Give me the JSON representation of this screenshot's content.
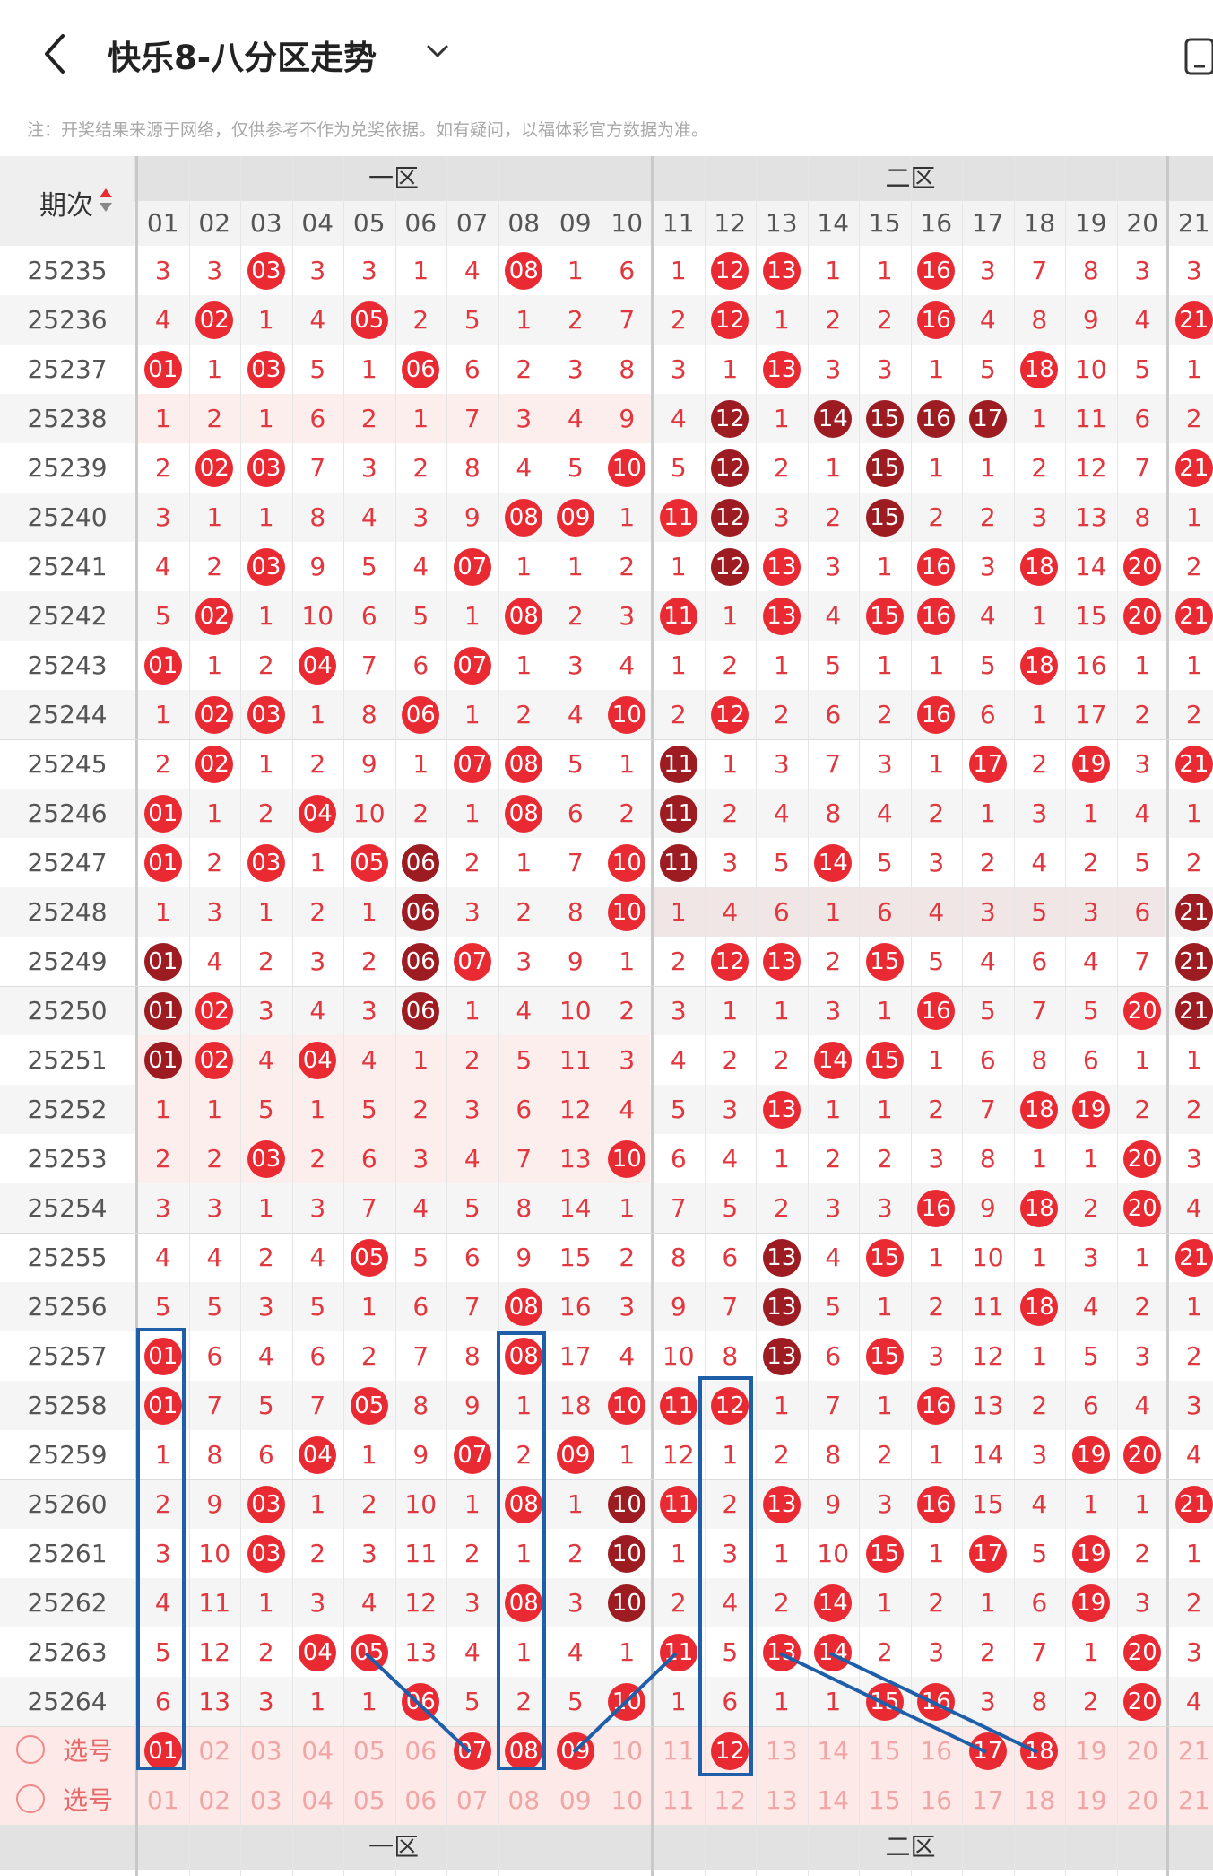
{
  "header": {
    "title": "快乐8-八分区走势",
    "note": "注：开奖结果来源于网络，仅供参考不作为兑奖依据。如有疑问，以福体彩官方数据为准。"
  },
  "table": {
    "period_label": "期次",
    "zones": [
      "一区",
      "二区"
    ],
    "columns": [
      "01",
      "02",
      "03",
      "04",
      "05",
      "06",
      "07",
      "08",
      "09",
      "10",
      "11",
      "12",
      "13",
      "14",
      "15",
      "16",
      "17",
      "18",
      "19",
      "20",
      "21"
    ],
    "rows": [
      {
        "period": "25235",
        "cells": [
          "3",
          "3",
          "03",
          "3",
          "3",
          "1",
          "4",
          "08",
          "1",
          "6",
          "1",
          "12",
          "13",
          "1",
          "1",
          "16",
          "3",
          "7",
          "8",
          "3",
          "3"
        ]
      },
      {
        "period": "25236",
        "cells": [
          "4",
          "02",
          "1",
          "4",
          "05",
          "2",
          "5",
          "1",
          "2",
          "7",
          "2",
          "12",
          "1",
          "2",
          "2",
          "16",
          "4",
          "8",
          "9",
          "4",
          "21"
        ]
      },
      {
        "period": "25237",
        "cells": [
          "01",
          "1",
          "03",
          "5",
          "1",
          "06",
          "6",
          "2",
          "3",
          "8",
          "3",
          "1",
          "13",
          "3",
          "3",
          "1",
          "5",
          "18",
          "10",
          "5",
          "1"
        ]
      },
      {
        "period": "25238",
        "cells": [
          "1",
          "2",
          "1",
          "6",
          "2",
          "1",
          "7",
          "3",
          "4",
          "9",
          "4",
          "12",
          "1",
          "14",
          "15",
          "16",
          "17",
          "1",
          "11",
          "6",
          "2"
        ]
      },
      {
        "period": "25239",
        "cells": [
          "2",
          "02",
          "03",
          "7",
          "3",
          "2",
          "8",
          "4",
          "5",
          "10",
          "5",
          "12",
          "2",
          "1",
          "15",
          "1",
          "1",
          "2",
          "12",
          "7",
          "21"
        ]
      },
      {
        "period": "25240",
        "cells": [
          "3",
          "1",
          "1",
          "8",
          "4",
          "3",
          "9",
          "08",
          "09",
          "1",
          "11",
          "12",
          "3",
          "2",
          "15",
          "2",
          "2",
          "3",
          "13",
          "8",
          "1"
        ]
      },
      {
        "period": "25241",
        "cells": [
          "4",
          "2",
          "03",
          "9",
          "5",
          "4",
          "07",
          "1",
          "1",
          "2",
          "1",
          "12",
          "13",
          "3",
          "1",
          "16",
          "3",
          "18",
          "14",
          "20",
          "2"
        ]
      },
      {
        "period": "25242",
        "cells": [
          "5",
          "02",
          "1",
          "10",
          "6",
          "5",
          "1",
          "08",
          "2",
          "3",
          "11",
          "1",
          "13",
          "4",
          "15",
          "16",
          "4",
          "1",
          "15",
          "20",
          "21"
        ]
      },
      {
        "period": "25243",
        "cells": [
          "01",
          "1",
          "2",
          "04",
          "7",
          "6",
          "07",
          "1",
          "3",
          "4",
          "1",
          "2",
          "1",
          "5",
          "1",
          "1",
          "5",
          "18",
          "16",
          "1",
          "1"
        ]
      },
      {
        "period": "25244",
        "cells": [
          "1",
          "02",
          "03",
          "1",
          "8",
          "06",
          "1",
          "2",
          "4",
          "10",
          "2",
          "12",
          "2",
          "6",
          "2",
          "16",
          "6",
          "1",
          "17",
          "2",
          "2"
        ]
      },
      {
        "period": "25245",
        "cells": [
          "2",
          "02",
          "1",
          "2",
          "9",
          "1",
          "07",
          "08",
          "5",
          "1",
          "11",
          "1",
          "3",
          "7",
          "3",
          "1",
          "17",
          "2",
          "19",
          "3",
          "21"
        ]
      },
      {
        "period": "25246",
        "cells": [
          "01",
          "1",
          "2",
          "04",
          "10",
          "2",
          "1",
          "08",
          "6",
          "2",
          "11",
          "2",
          "4",
          "8",
          "4",
          "2",
          "1",
          "3",
          "1",
          "4",
          "1"
        ]
      },
      {
        "period": "25247",
        "cells": [
          "01",
          "2",
          "03",
          "1",
          "05",
          "06",
          "2",
          "1",
          "7",
          "10",
          "11",
          "3",
          "5",
          "14",
          "5",
          "3",
          "2",
          "4",
          "2",
          "5",
          "2"
        ]
      },
      {
        "period": "25248",
        "cells": [
          "1",
          "3",
          "1",
          "2",
          "1",
          "06",
          "3",
          "2",
          "8",
          "10",
          "1",
          "4",
          "6",
          "1",
          "6",
          "4",
          "3",
          "5",
          "3",
          "6",
          "21"
        ]
      },
      {
        "period": "25249",
        "cells": [
          "01",
          "4",
          "2",
          "3",
          "2",
          "06",
          "07",
          "3",
          "9",
          "1",
          "2",
          "12",
          "13",
          "2",
          "15",
          "5",
          "4",
          "6",
          "4",
          "7",
          "21"
        ]
      },
      {
        "period": "25250",
        "cells": [
          "01",
          "02",
          "3",
          "4",
          "3",
          "06",
          "1",
          "4",
          "10",
          "2",
          "3",
          "1",
          "1",
          "3",
          "1",
          "16",
          "5",
          "7",
          "5",
          "20",
          "21"
        ]
      },
      {
        "period": "25251",
        "cells": [
          "01",
          "02",
          "4",
          "04",
          "4",
          "1",
          "2",
          "5",
          "11",
          "3",
          "4",
          "2",
          "2",
          "14",
          "15",
          "1",
          "6",
          "8",
          "6",
          "1",
          "1"
        ]
      },
      {
        "period": "25252",
        "cells": [
          "1",
          "1",
          "5",
          "1",
          "5",
          "2",
          "3",
          "6",
          "12",
          "4",
          "5",
          "3",
          "13",
          "1",
          "1",
          "2",
          "7",
          "18",
          "19",
          "2",
          "2"
        ]
      },
      {
        "period": "25253",
        "cells": [
          "2",
          "2",
          "03",
          "2",
          "6",
          "3",
          "4",
          "7",
          "13",
          "10",
          "6",
          "4",
          "1",
          "2",
          "2",
          "3",
          "8",
          "1",
          "1",
          "20",
          "3"
        ]
      },
      {
        "period": "25254",
        "cells": [
          "3",
          "3",
          "1",
          "3",
          "7",
          "4",
          "5",
          "8",
          "14",
          "1",
          "7",
          "5",
          "2",
          "3",
          "3",
          "16",
          "9",
          "18",
          "2",
          "20",
          "4"
        ]
      },
      {
        "period": "25255",
        "cells": [
          "4",
          "4",
          "2",
          "4",
          "05",
          "5",
          "6",
          "9",
          "15",
          "2",
          "8",
          "6",
          "13",
          "4",
          "15",
          "1",
          "10",
          "1",
          "3",
          "1",
          "21"
        ]
      },
      {
        "period": "25256",
        "cells": [
          "5",
          "5",
          "3",
          "5",
          "1",
          "6",
          "7",
          "08",
          "16",
          "3",
          "9",
          "7",
          "13",
          "5",
          "1",
          "2",
          "11",
          "18",
          "4",
          "2",
          "1"
        ]
      },
      {
        "period": "25257",
        "cells": [
          "01",
          "6",
          "4",
          "6",
          "2",
          "7",
          "8",
          "08",
          "17",
          "4",
          "10",
          "8",
          "13",
          "6",
          "15",
          "3",
          "12",
          "1",
          "5",
          "3",
          "2"
        ]
      },
      {
        "period": "25258",
        "cells": [
          "01",
          "7",
          "5",
          "7",
          "05",
          "8",
          "9",
          "1",
          "18",
          "10",
          "11",
          "12",
          "1",
          "7",
          "1",
          "16",
          "13",
          "2",
          "6",
          "4",
          "3"
        ]
      },
      {
        "period": "25259",
        "cells": [
          "1",
          "8",
          "6",
          "04",
          "1",
          "9",
          "07",
          "2",
          "09",
          "1",
          "12",
          "1",
          "2",
          "8",
          "2",
          "1",
          "14",
          "3",
          "19",
          "20",
          "4"
        ]
      },
      {
        "period": "25260",
        "cells": [
          "2",
          "9",
          "03",
          "1",
          "2",
          "10",
          "1",
          "08",
          "1",
          "10",
          "11",
          "2",
          "13",
          "9",
          "3",
          "16",
          "15",
          "4",
          "1",
          "1",
          "21"
        ]
      },
      {
        "period": "25261",
        "cells": [
          "3",
          "10",
          "03",
          "2",
          "3",
          "11",
          "2",
          "1",
          "2",
          "10",
          "1",
          "3",
          "1",
          "10",
          "15",
          "1",
          "17",
          "5",
          "19",
          "2",
          "1"
        ]
      },
      {
        "period": "25262",
        "cells": [
          "4",
          "11",
          "1",
          "3",
          "4",
          "12",
          "3",
          "08",
          "3",
          "10",
          "2",
          "4",
          "2",
          "14",
          "1",
          "2",
          "1",
          "6",
          "19",
          "3",
          "2"
        ]
      },
      {
        "period": "25263",
        "cells": [
          "5",
          "12",
          "2",
          "04",
          "05",
          "13",
          "4",
          "1",
          "4",
          "1",
          "11",
          "5",
          "13",
          "14",
          "2",
          "3",
          "2",
          "7",
          "1",
          "20",
          "3"
        ]
      },
      {
        "period": "25264",
        "cells": [
          "6",
          "13",
          "3",
          "1",
          "1",
          "06",
          "5",
          "2",
          "5",
          "10",
          "1",
          "6",
          "1",
          "1",
          "15",
          "16",
          "3",
          "8",
          "2",
          "20",
          "4"
        ]
      }
    ],
    "selection_rows": [
      {
        "label": "选号",
        "numbers": [
          "01",
          "02",
          "03",
          "04",
          "05",
          "06",
          "07",
          "08",
          "09",
          "10",
          "11",
          "12",
          "13",
          "14",
          "15",
          "16",
          "17",
          "18",
          "19",
          "20",
          "21"
        ],
        "picked": [
          "01",
          "07",
          "08",
          "09",
          "12",
          "17",
          "18"
        ]
      },
      {
        "label": "选号",
        "numbers": [
          "01",
          "02",
          "03",
          "04",
          "05",
          "06",
          "07",
          "08",
          "09",
          "10",
          "11",
          "12",
          "13",
          "14",
          "15",
          "16",
          "17",
          "18",
          "19",
          "20",
          "21"
        ],
        "picked": []
      }
    ]
  },
  "colors": {
    "accent_red": "#e92a32",
    "dark_red": "#9c1c22",
    "miss_text": "#e0383e",
    "annotation_blue": "#1f5faa"
  }
}
